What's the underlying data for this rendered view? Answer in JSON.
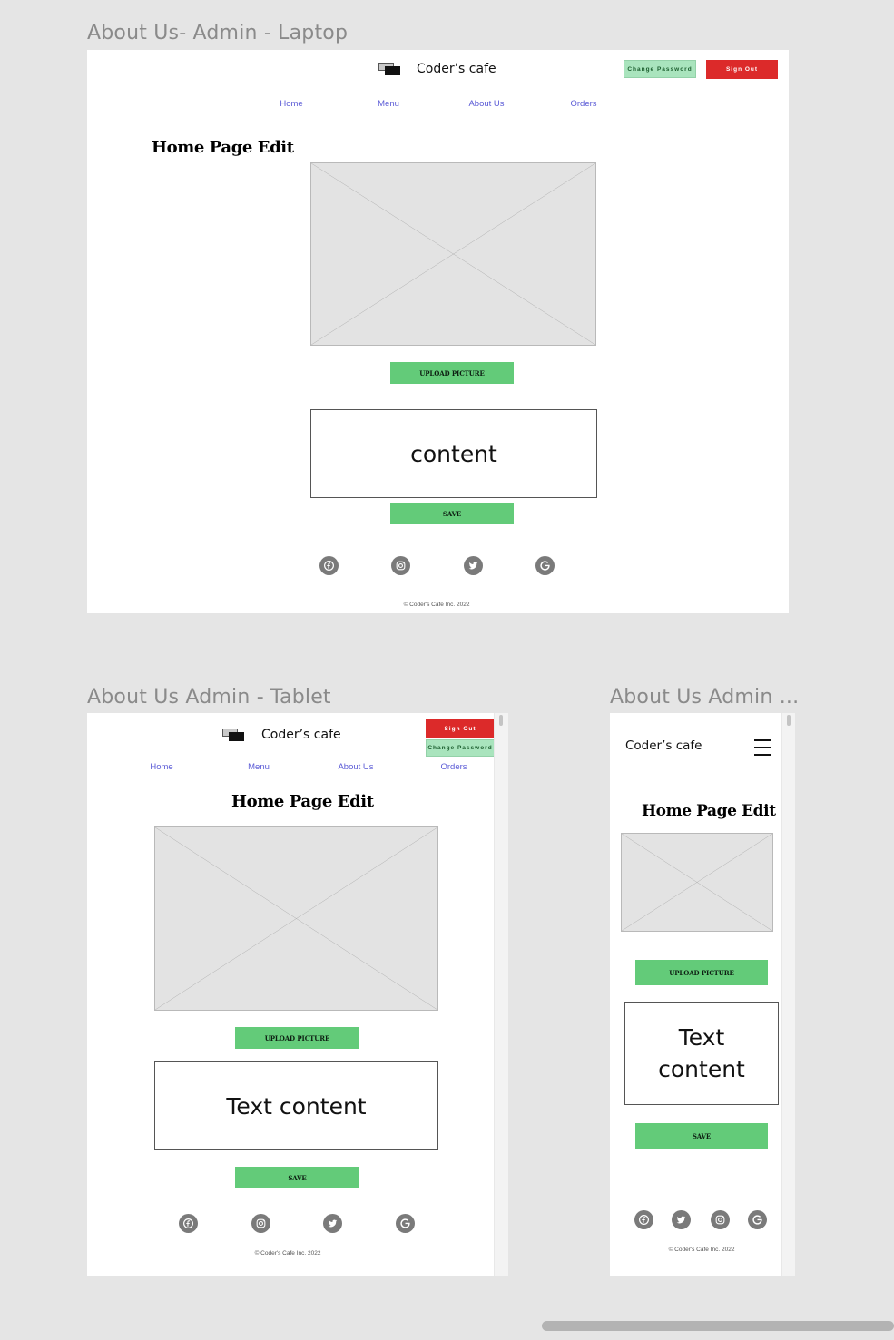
{
  "frames": {
    "laptop": {
      "title": "About Us- Admin - Laptop",
      "brand": "Coder’s cafe",
      "change_password": "Change Password",
      "sign_out": "Sign Out",
      "nav": [
        "Home",
        "Menu",
        "About Us",
        "Orders"
      ],
      "heading": "Home Page Edit",
      "upload_label": "UPLOAD PICTURE",
      "content_text": "content",
      "save_label": "SAVE",
      "copyright": "© Coder's Cafe Inc. 2022"
    },
    "tablet": {
      "title": "About Us Admin - Tablet",
      "brand": "Coder’s cafe",
      "sign_out": "Sign Out",
      "change_password": "Change Password",
      "nav": [
        "Home",
        "Menu",
        "About Us",
        "Orders"
      ],
      "heading": "Home Page Edit",
      "upload_label": "UPLOAD PICTURE",
      "content_text": "Text content",
      "save_label": "SAVE",
      "copyright": "© Coder's Cafe Inc. 2022"
    },
    "mobile": {
      "title": "About Us Admin ...",
      "brand": "Coder’s cafe",
      "heading": "Home Page Edit",
      "upload_label": "UPLOAD PICTURE",
      "content_text": "Text content",
      "save_label": "SAVE",
      "copyright": "© Coder's Cafe Inc. 2022"
    }
  },
  "social_icons": [
    "facebook-icon",
    "instagram-icon",
    "twitter-icon",
    "google-icon"
  ],
  "colors": {
    "canvas_bg": "#e5e5e5",
    "green_button": "#63cb79",
    "change_password_bg": "#a9e4bd",
    "sign_out_bg": "#dc2a2a",
    "nav_link": "#5b5bd6",
    "placeholder_bg": "#e3e3e3",
    "social_icon_bg": "#7a7a7a"
  }
}
